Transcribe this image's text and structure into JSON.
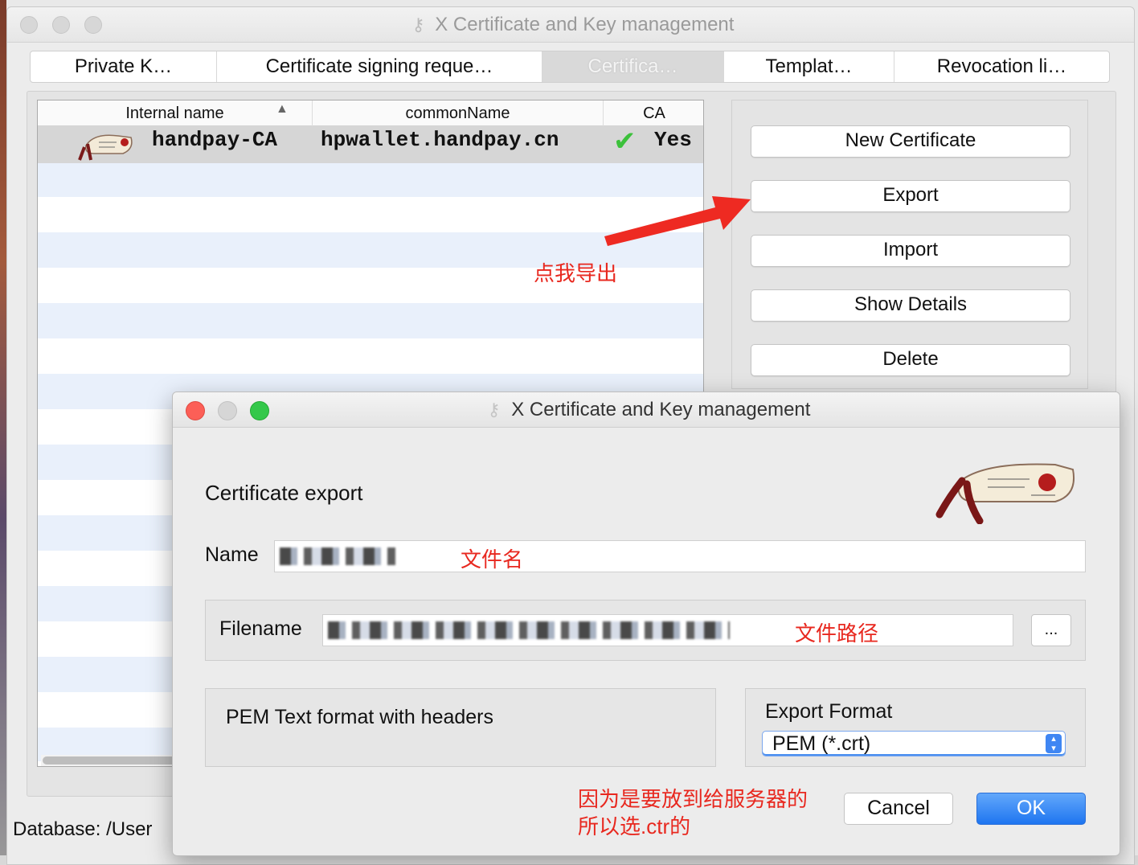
{
  "window": {
    "title": "X Certificate and Key management"
  },
  "tabs": [
    {
      "label": "Private K…"
    },
    {
      "label": "Certificate signing reque…"
    },
    {
      "label": "Certifica…"
    },
    {
      "label": "Templat…"
    },
    {
      "label": "Revocation li…"
    }
  ],
  "table": {
    "columns": [
      "Internal name",
      "commonName",
      "CA"
    ],
    "sort_indicator": "▲",
    "rows": [
      {
        "internal_name": "handpay-CA",
        "common_name": "hpwallet.handpay.cn",
        "ca_check": "✔",
        "ca": "Yes"
      }
    ]
  },
  "actions": {
    "new_certificate": "New Certificate",
    "export": "Export",
    "import": "Import",
    "show_details": "Show Details",
    "delete": "Delete"
  },
  "annotations": {
    "click_export": "点我导出",
    "file_name": "文件名",
    "file_path": "文件路径",
    "format_note_line1": "因为是要放到给服务器的",
    "format_note_line2": "所以选.ctr的"
  },
  "status_bar": {
    "database": "Database: /User"
  },
  "dialog": {
    "title": "X Certificate and Key management",
    "heading": "Certificate export",
    "name_label": "Name",
    "filename_label": "Filename",
    "browse_label": "...",
    "format_description": "PEM Text format with headers",
    "export_format_label": "Export Format",
    "export_format_value": "PEM (*.crt)",
    "cancel_label": "Cancel",
    "ok_label": "OK"
  },
  "colors": {
    "annotation": "#e8281f",
    "accent": "#1e75f0",
    "check": "#3cc13b"
  }
}
